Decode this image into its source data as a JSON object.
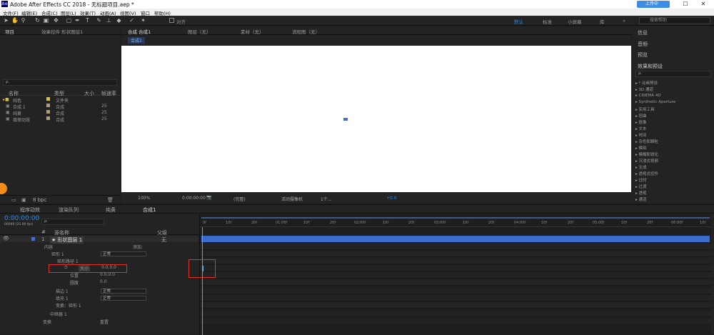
{
  "window": {
    "title": "Adobe After Effects CC 2018 - 无标题项目.aep *",
    "minimize": "—",
    "maximize": "☐",
    "close": "✕",
    "cloud_badge": "上传中"
  },
  "menu": [
    "文件(F)",
    "编辑(E)",
    "合成(C)",
    "图层(L)",
    "效果(T)",
    "动画(A)",
    "视图(V)",
    "窗口",
    "帮助(H)"
  ],
  "toolbar": {
    "snap_label": "对齐",
    "workspaces": [
      "默认",
      "标准",
      "小屏幕",
      "库"
    ],
    "search_placeholder": "搜索帮助"
  },
  "project": {
    "tab": "项目",
    "effects_tab": "效果控件 形状图层1",
    "search_icon": "ρ.",
    "cols": [
      "名称",
      "类型",
      "大小",
      "帧速率"
    ],
    "items": [
      {
        "name": "纯色",
        "type": "文件夹",
        "size": "",
        "fps": ""
      },
      {
        "name": "合成 1",
        "type": "合成",
        "size": "",
        "fps": "25"
      },
      {
        "name": "纯黄",
        "type": "合成",
        "size": "",
        "fps": "25"
      },
      {
        "name": "填保动效",
        "type": "合成",
        "size": "",
        "fps": "25"
      }
    ],
    "bpc": "8 bpc"
  },
  "comp_viewer": {
    "tabs": [
      "合成 合成1",
      "图层（无）",
      "素材（无）",
      "流程图（无）"
    ],
    "breadcrumb": "合成1",
    "zoom": "100%",
    "timecode": "0:00:00:00",
    "quality": "(完整)",
    "camera": "活动摄像机",
    "views": "1个...",
    "exposure": "+0.0"
  },
  "right_panel": {
    "items": [
      "信息",
      "音频",
      "预览",
      "效果和预设"
    ],
    "search_icon": "ρ.",
    "effects": [
      "▸ * 动画预设",
      "▸ 3D 通道",
      "▸ CINEMA 4D",
      "▸ Synthetic Aperture",
      "▸ 实用工具",
      "▸ 扭曲",
      "▸ 抠像",
      "▸ 文本",
      "▸ 时间",
      "▸ 杂色和颗粒",
      "▸ 模拟",
      "▸ 模糊和锐化",
      "▸ 沉浸式视频",
      "▸ 生成",
      "▸ 透视式控件",
      "▸ 过时",
      "▸ 过渡",
      "▸ 透视",
      "▸ 通道",
      "▸ 遮罩"
    ]
  },
  "timeline": {
    "tabs": [
      "程序动效",
      "渲染队列",
      "纯黄",
      "合成1"
    ],
    "timecode": "0:00:00:00",
    "frames": "00000 (25.00 fps)",
    "col_headers": {
      "num": "#",
      "layer_name": "源名称",
      "parent": "父级"
    },
    "layer": {
      "num": "1",
      "name": "★ 形状图层 1",
      "parent": "无"
    },
    "props": {
      "contents": "内容",
      "add": "添加:",
      "rect1": "矩形 1",
      "rect_mode": "正常",
      "rect_path": "矩形路径 1",
      "size": "大小",
      "size_val": "0.0,0.0",
      "position": "位置",
      "position_val": "0.0,0.0",
      "roundness": "圆度",
      "roundness_val": "0.0",
      "stroke": "描边 1",
      "stroke_mode": "正常",
      "fill": "填充 1",
      "fill_mode": "正常",
      "transform_rect": "变换：矩形 1",
      "mid_fx": "中继器 1",
      "transform": "变换",
      "reset": "重置"
    },
    "ruler": [
      "0f",
      "10f",
      "20f",
      "01:00f",
      "10f",
      "20f",
      "02:00f",
      "10f",
      "20f",
      "03:00f",
      "10f",
      "20f",
      "04:00f",
      "10f",
      "20f",
      "05:00f",
      "10f",
      "20f",
      "06:00f",
      "10f"
    ]
  },
  "colors": {
    "accent": "#2d8ceb",
    "highlight": "#e0312b",
    "layer_bar": "#3b6ccb"
  }
}
